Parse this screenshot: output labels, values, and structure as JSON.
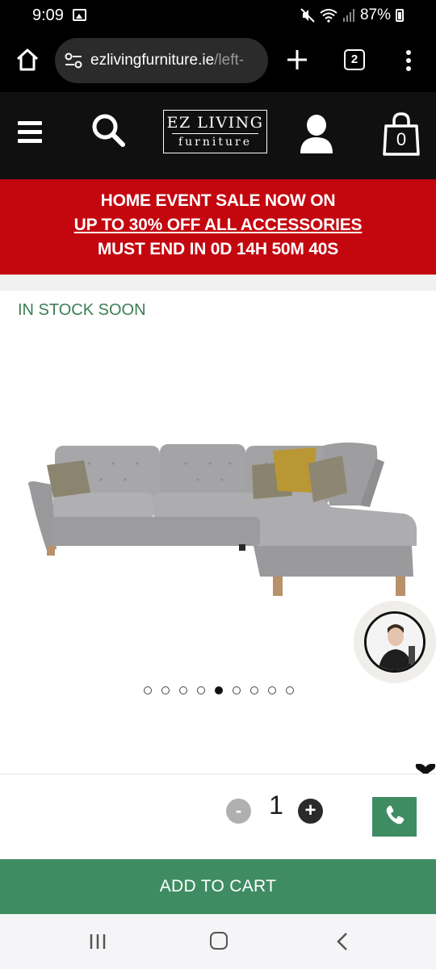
{
  "status_bar": {
    "time": "9:09",
    "battery": "87%",
    "icons": [
      "gallery-icon",
      "mute-icon",
      "wifi-icon",
      "signal-icon",
      "battery-icon"
    ]
  },
  "browser": {
    "url_domain": "ezlivingfurniture.ie",
    "url_path": "/left-",
    "tab_count": "2"
  },
  "header": {
    "logo_line1": "EZ LIVING",
    "logo_line2": "furniture",
    "cart_count": "0"
  },
  "promo": {
    "line1": "HOME EVENT SALE NOW ON",
    "line2": "UP TO 30% OFF ALL ACCESSORIES",
    "line3": "MUST END IN 0D 14H 50M 40S"
  },
  "product": {
    "stock_status": "IN STOCK SOON",
    "image_alt": "sofa-image",
    "carousel": {
      "total": 9,
      "active": 5
    }
  },
  "purchase": {
    "minus_label": "-",
    "quantity": "1",
    "plus_label": "+",
    "add_to_cart": "ADD TO CART"
  },
  "colors": {
    "header_bg": "#111010",
    "promo_red": "#c4060f",
    "brand_green": "#3f8c63",
    "stock_green": "#3b7d55"
  }
}
